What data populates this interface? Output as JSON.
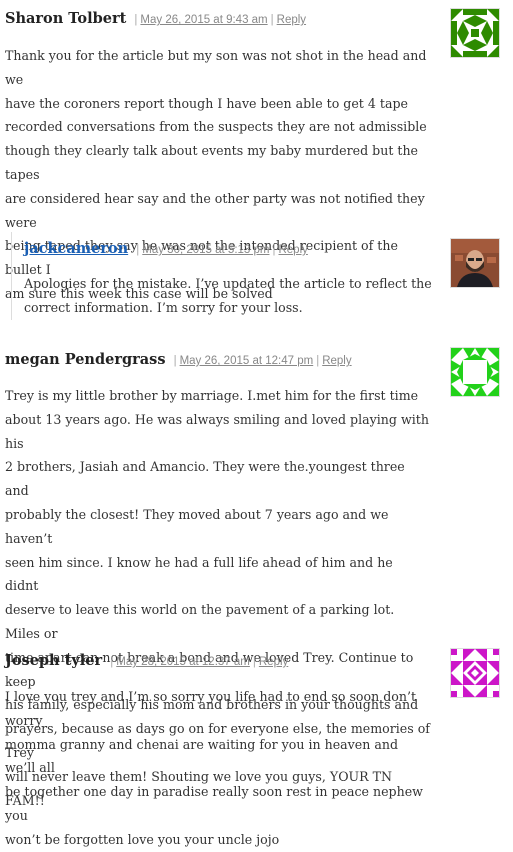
{
  "comments": [
    {
      "author": "Sharon Tolbert",
      "date": "May 26, 2015 at 9:43 am",
      "reply_label": "Reply",
      "avatar_icon": "identicon-green-quilt",
      "avatar_color": "#2e8b00",
      "lines": [
        "Thank you for the article but my son was not shot in the head and we",
        "have the coroners report though I have been able to get 4 tape",
        "recorded conversations from the suspects they are not admissible",
        "though they clearly talk about events my baby murdered but the tapes",
        "are considered hear say and the other party was not notified they were",
        "being taped they say he was not the intended recipient of the bullet I",
        "am sure this week this case will be solved"
      ]
    },
    {
      "author": "jackcameron",
      "date": "May 30, 2015 at 5:13 pm",
      "reply_label": "Reply",
      "avatar_icon": "profile-photo-icon",
      "is_reply": true,
      "lines": [
        "Apologies for the mistake. I’ve updated the article to reflect the",
        "correct information. I’m sorry for your loss."
      ]
    },
    {
      "author": "megan Pendergrass",
      "date": "May 26, 2015 at 12:47 pm",
      "reply_label": "Reply",
      "avatar_icon": "identicon-bright-green",
      "avatar_color": "#22d11a",
      "lines": [
        "Trey is my little brother by marriage. I.met him for the first time",
        "about 13 years ago. He was always smiling and loved playing with his",
        "2 brothers, Jasiah and Amancio. They were the.youngest three and",
        "probably the closest! They moved about 7 years ago and we haven’t",
        "seen him since. I know he had a full life ahead of him and he didnt",
        "deserve to leave this world on the pavement of a parking lot. Miles or",
        "time apart can not break a bond and we loved Trey. Continue to keep",
        "his family, especially his mom and brothers in your thoughts and",
        "prayers, because as days go on for everyone else, the memories of Trey",
        "will never leave them! Shouting we love you guys, YOUR TN FAM!!"
      ]
    },
    {
      "author": "Joseph tyler",
      "date": "May 28, 2015 at 12:37 am",
      "reply_label": "Reply",
      "avatar_icon": "identicon-magenta",
      "avatar_color": "#cc16c8",
      "lines": [
        "I love you trey and I’m so sorry you life had to end so soon don’t worry",
        "momma granny and chenai are waiting for you in heaven and we’ll all",
        "be together one day in paradise really soon rest in peace nephew you",
        "won’t be forgotten love you your uncle jojo"
      ]
    }
  ]
}
